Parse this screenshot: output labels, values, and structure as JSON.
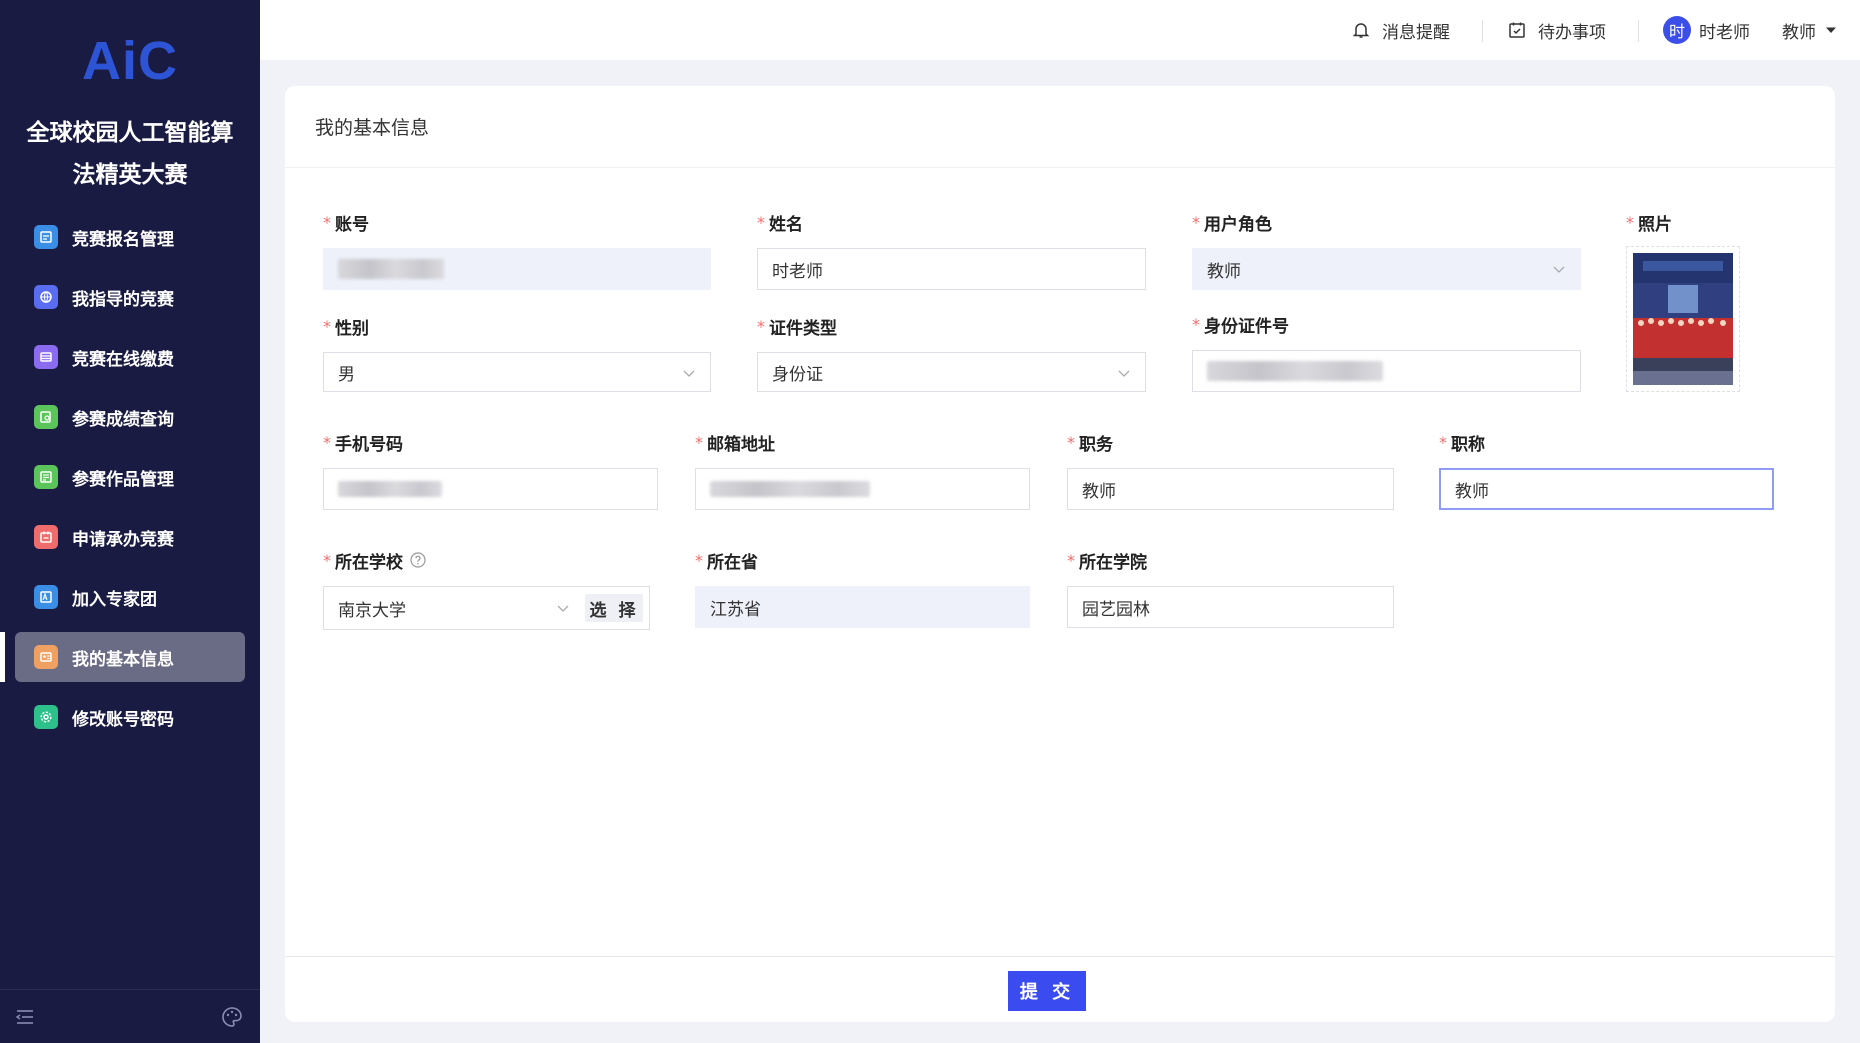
{
  "sidebar": {
    "logo": "AiC",
    "title_line1": "全球校园人工智能算",
    "title_line2": "法精英大赛",
    "items": [
      {
        "label": "竞赛报名管理",
        "icon": "form-icon",
        "color": "#3a8ee6"
      },
      {
        "label": "我指导的竞赛",
        "icon": "globe-icon",
        "color": "#5a6cf0"
      },
      {
        "label": "竞赛在线缴费",
        "icon": "payment-icon",
        "color": "#8b6cf0"
      },
      {
        "label": "参赛成绩查询",
        "icon": "search-doc-icon",
        "color": "#5bc45b"
      },
      {
        "label": "参赛作品管理",
        "icon": "works-icon",
        "color": "#5bc45b"
      },
      {
        "label": "申请承办竞赛",
        "icon": "apply-icon",
        "color": "#f06c6c"
      },
      {
        "label": "加入专家团",
        "icon": "expert-icon",
        "color": "#3a8ee6"
      },
      {
        "label": "我的基本信息",
        "icon": "profile-icon",
        "color": "#f0a060",
        "active": true
      },
      {
        "label": "修改账号密码",
        "icon": "settings-icon",
        "color": "#2ec08a"
      }
    ]
  },
  "topbar": {
    "notify": "消息提醒",
    "todo": "待办事项",
    "avatar_char": "时",
    "username": "时老师",
    "role": "教师"
  },
  "card": {
    "title": "我的基本信息",
    "submit": "提 交"
  },
  "form": {
    "account": {
      "label": "账号"
    },
    "name": {
      "label": "姓名",
      "value": "时老师"
    },
    "user_role": {
      "label": "用户角色",
      "value": "教师"
    },
    "photo": {
      "label": "照片"
    },
    "gender": {
      "label": "性别",
      "value": "男"
    },
    "id_type": {
      "label": "证件类型",
      "value": "身份证"
    },
    "id_number": {
      "label": "身份证件号"
    },
    "phone": {
      "label": "手机号码"
    },
    "email": {
      "label": "邮箱地址"
    },
    "position": {
      "label": "职务",
      "value": "教师"
    },
    "title": {
      "label": "职称",
      "value": "教师"
    },
    "school": {
      "label": "所在学校",
      "value": "南京大学",
      "choose": "选 择"
    },
    "province": {
      "label": "所在省",
      "value": "江苏省"
    },
    "college": {
      "label": "所在学院",
      "value": "园艺园林"
    }
  }
}
